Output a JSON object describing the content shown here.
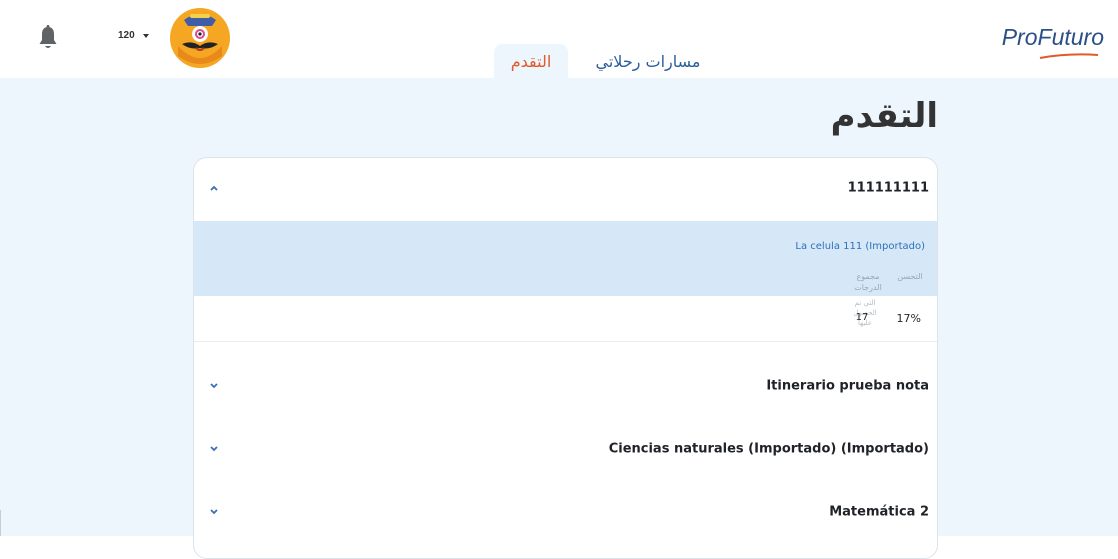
{
  "header": {
    "points": "120",
    "tabs": [
      {
        "label": "التقدم",
        "active": true
      },
      {
        "label": "مسارات رحلاتي",
        "active": false
      }
    ],
    "logo_pro": "Pro",
    "logo_futuro": "Futuro"
  },
  "page": {
    "title": "التقدم"
  },
  "accordion": [
    {
      "title": "111111111",
      "expanded": true,
      "course": "La celula 111 (Importado)",
      "columns": {
        "improvement": "التحسن",
        "total_label_1": "مجموع",
        "total_label_2": "الدرجات",
        "total_label_3": "التي تم",
        "total_label_4": "الحصول",
        "total_label_5": "عليها"
      },
      "row": {
        "improvement": "17%",
        "total": "17"
      }
    },
    {
      "title": "Itinerario prueba nota",
      "expanded": false
    },
    {
      "title": "Ciencias naturales (Importado) (Importado)",
      "expanded": false
    },
    {
      "title": "Matemática 2",
      "expanded": false
    }
  ],
  "colors": {
    "accent_orange": "#e05a2a",
    "tab_blue": "#2b5f9e",
    "link_blue": "#2f6fb8",
    "main_bg": "#eef6fd",
    "band_bg": "#d6e8f8"
  }
}
